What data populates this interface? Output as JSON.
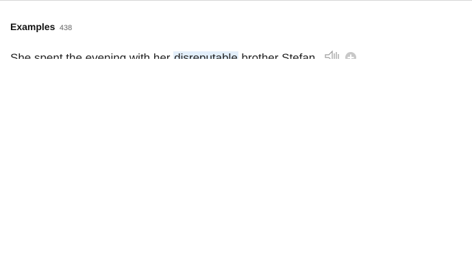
{
  "examples": {
    "title": "Examples",
    "count": "438",
    "items": [
      {
        "before": "She spent the evening with her ",
        "highlight": "disreputable",
        "after": " brother Stefan.",
        "audio_icon": "speaker-icon",
        "add_icon": "add-circle-icon"
      }
    ]
  },
  "colors": {
    "highlight": "#e3effb",
    "icon_gray": "#c8c8c8"
  }
}
